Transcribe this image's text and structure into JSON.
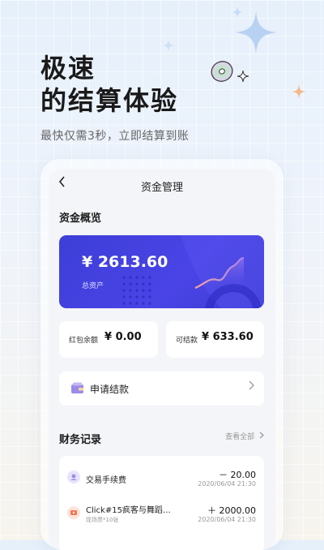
{
  "promo": {
    "headline_line1": "极速",
    "headline_line2": "的结算体验",
    "subtitle": "最快仅需3秒，立即结算到账"
  },
  "screen": {
    "nav_title": "资金管理",
    "overview_title": "资金概览",
    "balance": {
      "amount": "¥ 2613.60",
      "label": "总资产"
    },
    "red_packet": {
      "label": "红包余额",
      "value": "¥ 0.00"
    },
    "settleable": {
      "label": "可结款",
      "value": "¥ 633.60"
    },
    "apply_label": "申请结款",
    "records_title": "财务记录",
    "view_all": "查看全部",
    "records": [
      {
        "name": "交易手续费",
        "sub": "",
        "amount": "－ 20.00",
        "date": "2020/06/04  21:30"
      },
      {
        "name": "Click#15疯客与舞蹈…",
        "sub": "现场票*10张",
        "amount": "＋ 2000.00",
        "date": "2020/06/04  21:30"
      }
    ]
  },
  "colors": {
    "card_blue": "#4543e0",
    "record_icon_purple": "#9a8ce8",
    "record_icon_orange": "#f07a55"
  }
}
